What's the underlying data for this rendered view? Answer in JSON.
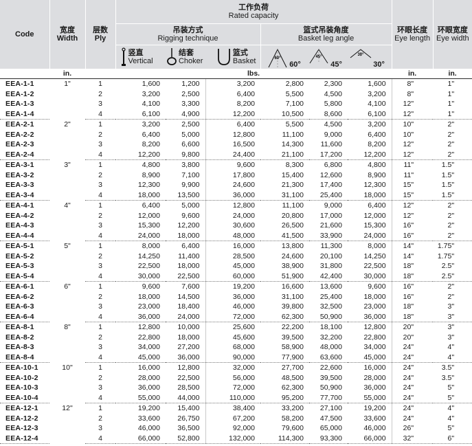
{
  "header": {
    "code": "Code",
    "width_cn": "宽度",
    "width_en": "Width",
    "ply_cn": "层数",
    "ply_en": "Ply",
    "capacity_cn": "工作负荷",
    "capacity_en": "Rated capacity",
    "rigging_cn": "吊装方式",
    "rigging_en": "Rigging technique",
    "basket_angle_cn": "篮式吊装角度",
    "basket_angle_en": "Basket leg angle",
    "eye_length_cn": "环眼长度",
    "eye_length_en": "Eye length",
    "eye_width_cn": "环眼宽度",
    "eye_width_en": "Eye width",
    "vertical_cn": "竖直",
    "vertical_en": "Vertical",
    "choker_cn": "结套",
    "choker_en": "Choker",
    "basket_cn": "篮式",
    "basket_en": "Basket",
    "angle_60_icon": "60°",
    "angle_60": "60°",
    "angle_45_icon": "45°",
    "angle_45": "45°",
    "angle_30_icon": "30°",
    "angle_30": "30°"
  },
  "units": {
    "width": "in.",
    "capacity": "lbs.",
    "eye_length": "in.",
    "eye_width": "in."
  },
  "groups": [
    {
      "width": "1\"",
      "rows": [
        {
          "code": "EEA-1-1",
          "ply": "1",
          "v": "1,600",
          "c": "1,200",
          "b": "3,200",
          "a60": "2,800",
          "a45": "2,300",
          "a30": "1,600",
          "el": "8\"",
          "ew": "1\""
        },
        {
          "code": "EEA-1-2",
          "ply": "2",
          "v": "3,200",
          "c": "2,500",
          "b": "6,400",
          "a60": "5,500",
          "a45": "4,500",
          "a30": "3,200",
          "el": "8\"",
          "ew": "1\""
        },
        {
          "code": "EEA-1-3",
          "ply": "3",
          "v": "4,100",
          "c": "3,300",
          "b": "8,200",
          "a60": "7,100",
          "a45": "5,800",
          "a30": "4,100",
          "el": "12\"",
          "ew": "1\""
        },
        {
          "code": "EEA-1-4",
          "ply": "4",
          "v": "6,100",
          "c": "4,900",
          "b": "12,200",
          "a60": "10,500",
          "a45": "8,600",
          "a30": "6,100",
          "el": "12\"",
          "ew": "1\""
        }
      ]
    },
    {
      "width": "2\"",
      "rows": [
        {
          "code": "EEA-2-1",
          "ply": "1",
          "v": "3,200",
          "c": "2,500",
          "b": "6,400",
          "a60": "5,500",
          "a45": "4,500",
          "a30": "3,200",
          "el": "10\"",
          "ew": "2\""
        },
        {
          "code": "EEA-2-2",
          "ply": "2",
          "v": "6,400",
          "c": "5,000",
          "b": "12,800",
          "a60": "11,100",
          "a45": "9,000",
          "a30": "6,400",
          "el": "10\"",
          "ew": "2\""
        },
        {
          "code": "EEA-2-3",
          "ply": "3",
          "v": "8,200",
          "c": "6,600",
          "b": "16,500",
          "a60": "14,300",
          "a45": "11,600",
          "a30": "8,200",
          "el": "12\"",
          "ew": "2\""
        },
        {
          "code": "EEA-2-4",
          "ply": "4",
          "v": "12,200",
          "c": "9,800",
          "b": "24,400",
          "a60": "21,100",
          "a45": "17,200",
          "a30": "12,200",
          "el": "12\"",
          "ew": "2\""
        }
      ]
    },
    {
      "width": "3\"",
      "rows": [
        {
          "code": "EEA-3-1",
          "ply": "1",
          "v": "4,800",
          "c": "3,800",
          "b": "9,600",
          "a60": "8,300",
          "a45": "6,800",
          "a30": "4,800",
          "el": "11\"",
          "ew": "1.5\""
        },
        {
          "code": "EEA-3-2",
          "ply": "2",
          "v": "8,900",
          "c": "7,100",
          "b": "17,800",
          "a60": "15,400",
          "a45": "12,600",
          "a30": "8,900",
          "el": "11\"",
          "ew": "1.5\""
        },
        {
          "code": "EEA-3-3",
          "ply": "3",
          "v": "12,300",
          "c": "9,900",
          "b": "24,600",
          "a60": "21,300",
          "a45": "17,400",
          "a30": "12,300",
          "el": "15\"",
          "ew": "1.5\""
        },
        {
          "code": "EEA-3-4",
          "ply": "4",
          "v": "18,000",
          "c": "13,500",
          "b": "36,000",
          "a60": "31,100",
          "a45": "25,400",
          "a30": "18,000",
          "el": "15\"",
          "ew": "1.5\""
        }
      ]
    },
    {
      "width": "4\"",
      "rows": [
        {
          "code": "EEA-4-1",
          "ply": "1",
          "v": "6,400",
          "c": "5,000",
          "b": "12,800",
          "a60": "11,100",
          "a45": "9,000",
          "a30": "6,400",
          "el": "12\"",
          "ew": "2\""
        },
        {
          "code": "EEA-4-2",
          "ply": "2",
          "v": "12,000",
          "c": "9,600",
          "b": "24,000",
          "a60": "20,800",
          "a45": "17,000",
          "a30": "12,000",
          "el": "12\"",
          "ew": "2\""
        },
        {
          "code": "EEA-4-3",
          "ply": "3",
          "v": "15,300",
          "c": "12,200",
          "b": "30,600",
          "a60": "26,500",
          "a45": "21,600",
          "a30": "15,300",
          "el": "16\"",
          "ew": "2\""
        },
        {
          "code": "EEA-4-4",
          "ply": "4",
          "v": "24,000",
          "c": "18,000",
          "b": "48,000",
          "a60": "41,500",
          "a45": "33,900",
          "a30": "24,000",
          "el": "16\"",
          "ew": "2\""
        }
      ]
    },
    {
      "width": "5\"",
      "rows": [
        {
          "code": "EEA-5-1",
          "ply": "1",
          "v": "8,000",
          "c": "6,400",
          "b": "16,000",
          "a60": "13,800",
          "a45": "11,300",
          "a30": "8,000",
          "el": "14\"",
          "ew": "1.75\""
        },
        {
          "code": "EEA-5-2",
          "ply": "2",
          "v": "14,250",
          "c": "11,400",
          "b": "28,500",
          "a60": "24,600",
          "a45": "20,100",
          "a30": "14,250",
          "el": "14\"",
          "ew": "1.75\""
        },
        {
          "code": "EEA-5-3",
          "ply": "3",
          "v": "22,500",
          "c": "18,000",
          "b": "45,000",
          "a60": "38,900",
          "a45": "31,800",
          "a30": "22,500",
          "el": "18\"",
          "ew": "2.5\""
        },
        {
          "code": "EEA-5-4",
          "ply": "4",
          "v": "30,000",
          "c": "22,500",
          "b": "60,000",
          "a60": "51,900",
          "a45": "42,400",
          "a30": "30,000",
          "el": "18\"",
          "ew": "2.5\""
        }
      ]
    },
    {
      "width": "6\"",
      "rows": [
        {
          "code": "EEA-6-1",
          "ply": "1",
          "v": "9,600",
          "c": "7,600",
          "b": "19,200",
          "a60": "16,600",
          "a45": "13,600",
          "a30": "9,600",
          "el": "16\"",
          "ew": "2\""
        },
        {
          "code": "EEA-6-2",
          "ply": "2",
          "v": "18,000",
          "c": "14,500",
          "b": "36,000",
          "a60": "31,100",
          "a45": "25,400",
          "a30": "18,000",
          "el": "16\"",
          "ew": "2\""
        },
        {
          "code": "EEA-6-3",
          "ply": "3",
          "v": "23,000",
          "c": "18,400",
          "b": "46,000",
          "a60": "39,800",
          "a45": "32,500",
          "a30": "23,000",
          "el": "18\"",
          "ew": "3\""
        },
        {
          "code": "EEA-6-4",
          "ply": "4",
          "v": "36,000",
          "c": "24,000",
          "b": "72,000",
          "a60": "62,300",
          "a45": "50,900",
          "a30": "36,000",
          "el": "18\"",
          "ew": "3\""
        }
      ]
    },
    {
      "width": "8\"",
      "rows": [
        {
          "code": "EEA-8-1",
          "ply": "1",
          "v": "12,800",
          "c": "10,000",
          "b": "25,600",
          "a60": "22,200",
          "a45": "18,100",
          "a30": "12,800",
          "el": "20\"",
          "ew": "3\""
        },
        {
          "code": "EEA-8-2",
          "ply": "2",
          "v": "22,800",
          "c": "18,000",
          "b": "45,600",
          "a60": "39,500",
          "a45": "32,200",
          "a30": "22,800",
          "el": "20\"",
          "ew": "3\""
        },
        {
          "code": "EEA-8-3",
          "ply": "3",
          "v": "34,000",
          "c": "27,200",
          "b": "68,000",
          "a60": "58,900",
          "a45": "48,000",
          "a30": "34,000",
          "el": "24\"",
          "ew": "4\""
        },
        {
          "code": "EEA-8-4",
          "ply": "4",
          "v": "45,000",
          "c": "36,000",
          "b": "90,000",
          "a60": "77,900",
          "a45": "63,600",
          "a30": "45,000",
          "el": "24\"",
          "ew": "4\""
        }
      ]
    },
    {
      "width": "10\"",
      "rows": [
        {
          "code": "EEA-10-1",
          "ply": "1",
          "v": "16,000",
          "c": "12,800",
          "b": "32,000",
          "a60": "27,700",
          "a45": "22,600",
          "a30": "16,000",
          "el": "24\"",
          "ew": "3.5\""
        },
        {
          "code": "EEA-10-2",
          "ply": "2",
          "v": "28,000",
          "c": "22,500",
          "b": "56,000",
          "a60": "48,500",
          "a45": "39,500",
          "a30": "28,000",
          "el": "24\"",
          "ew": "3.5\""
        },
        {
          "code": "EEA-10-3",
          "ply": "3",
          "v": "36,000",
          "c": "28,500",
          "b": "72,000",
          "a60": "62,300",
          "a45": "50,900",
          "a30": "36,000",
          "el": "24\"",
          "ew": "5\""
        },
        {
          "code": "EEA-10-4",
          "ply": "4",
          "v": "55,000",
          "c": "44,000",
          "b": "110,000",
          "a60": "95,200",
          "a45": "77,700",
          "a30": "55,000",
          "el": "24\"",
          "ew": "5\""
        }
      ]
    },
    {
      "width": "12\"",
      "rows": [
        {
          "code": "EEA-12-1",
          "ply": "1",
          "v": "19,200",
          "c": "15,400",
          "b": "38,400",
          "a60": "33,200",
          "a45": "27,100",
          "a30": "19,200",
          "el": "24\"",
          "ew": "4\""
        },
        {
          "code": "EEA-12-2",
          "ply": "2",
          "v": "33,600",
          "c": "26,750",
          "b": "67,200",
          "a60": "58,200",
          "a45": "47,500",
          "a30": "33,600",
          "el": "24\"",
          "ew": "4\""
        },
        {
          "code": "EEA-12-3",
          "ply": "3",
          "v": "46,000",
          "c": "36,500",
          "b": "92,000",
          "a60": "79,600",
          "a45": "65,000",
          "a30": "46,000",
          "el": "26\"",
          "ew": "5\""
        },
        {
          "code": "EEA-12-4",
          "ply": "4",
          "v": "66,000",
          "c": "52,800",
          "b": "132,000",
          "a60": "114,300",
          "a45": "93,300",
          "a30": "66,000",
          "el": "32\"",
          "ew": "6\""
        }
      ]
    }
  ]
}
